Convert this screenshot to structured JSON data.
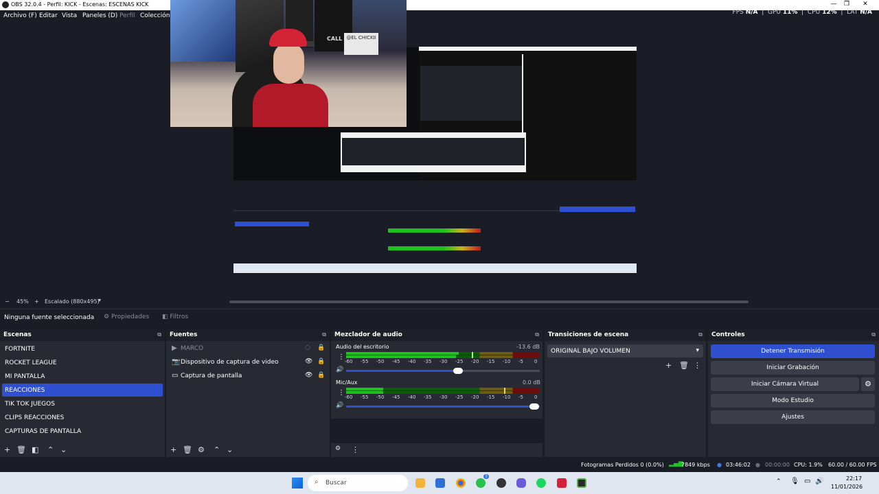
{
  "window": {
    "title": "OBS 32.0.4 - Perfil: KICK - Escenas: ESCENAS KICK",
    "minimize": "—",
    "maximize": "❐",
    "close": "✕"
  },
  "menu": {
    "items": [
      "Archivo (F)",
      "Editar",
      "Vista",
      "Paneles (D)",
      "Perfil",
      "Colección"
    ]
  },
  "stats": {
    "fps_label": "FPS",
    "fps_value": "N/A",
    "gpu_label": "GPU",
    "gpu_value": "11%",
    "cpu_label": "CPU",
    "cpu_value": "12%",
    "lat_label": "LAT",
    "lat_value": "N/A"
  },
  "webcam": {
    "sign": "@EL CHICKII",
    "cap": "CALL"
  },
  "zoombar": {
    "minus": "−",
    "zoom": "45%",
    "plus": "+",
    "scale": "Escalado (880x495)"
  },
  "context": {
    "no_source": "Ninguna fuente seleccionada",
    "properties": "Propiedades",
    "filters": "Filtros"
  },
  "scenes": {
    "title": "Escenas",
    "items": [
      "FORTNITE",
      "ROCKET LEAGUE",
      "MI PANTALLA",
      "REACCIONES",
      "TIK TOK JUEGOS",
      "CLIPS REACCIONES",
      "CAPTURAS DE PANTALLA"
    ],
    "selected_index": 3
  },
  "sources": {
    "title": "Fuentes",
    "items": [
      "MARCO",
      "Dispositivo de captura de video",
      "Captura de pantalla"
    ]
  },
  "mixer": {
    "title": "Mezclador de audio",
    "channels": [
      {
        "name": "Audio del escritorio",
        "db": "-13.6 dB",
        "level": 0.58,
        "volume": 0.62
      },
      {
        "name": "Mic/Aux",
        "db": "0.0 dB",
        "level": 0.19,
        "volume": 1.0
      }
    ],
    "ticks": [
      "-60",
      "-55",
      "-50",
      "-45",
      "-40",
      "-35",
      "-30",
      "-25",
      "-20",
      "-15",
      "-10",
      "-5",
      "0"
    ]
  },
  "transitions": {
    "title": "Transiciones de escena",
    "selected": "ORIGINAL BAJO VOLUMEN"
  },
  "controls": {
    "title": "Controles",
    "stop_stream": "Detener Transmisión",
    "start_record": "Iniciar Grabación",
    "start_vcam": "Iniciar Cámara Virtual",
    "studio_mode": "Modo Estudio",
    "settings": "Ajustes"
  },
  "status": {
    "dropped": "Fotogramas Perdidos 0 (0.0%)",
    "bitrate": "7849 kbps",
    "stream_time": "03:46:02",
    "rec_time": "00:00:00",
    "cpu": "CPU: 1.9%",
    "fps": "60.00 / 60.00 FPS"
  },
  "taskbar": {
    "search": "Buscar",
    "time": "22:17",
    "date": "11/01/2026",
    "badge_whatsapp": "3"
  },
  "colors": {
    "accent": "#2e4fd0",
    "meter_green": "#1ec21e",
    "meter_yellow": "#c9b21a",
    "meter_red": "#c01b1b"
  }
}
